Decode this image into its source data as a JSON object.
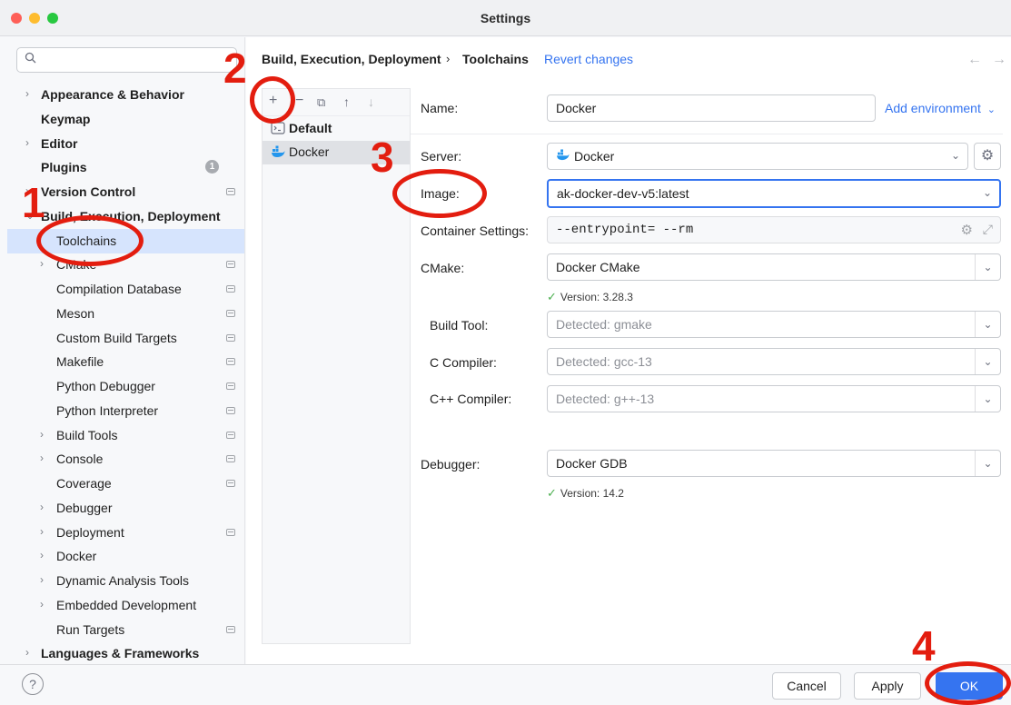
{
  "window": {
    "title": "Settings",
    "traffic_lights": [
      "#fe5f57",
      "#febc2e",
      "#28c840"
    ]
  },
  "sidebar": {
    "search_icon": "🔍",
    "items": [
      {
        "label": "Appearance & Behavior",
        "bold": true,
        "chevron": "›",
        "indent": 0
      },
      {
        "label": "Keymap",
        "bold": true,
        "chevron": "",
        "indent": 0
      },
      {
        "label": "Editor",
        "bold": true,
        "chevron": "›",
        "indent": 0
      },
      {
        "label": "Plugins",
        "bold": true,
        "chevron": "",
        "indent": 0,
        "badge": "1"
      },
      {
        "label": "Version Control",
        "bold": true,
        "chevron": "›",
        "indent": 0,
        "project": true
      },
      {
        "label": "Build, Execution, Deployment",
        "bold": true,
        "chevron": "⌄",
        "indent": 0
      },
      {
        "label": "Toolchains",
        "bold": false,
        "chevron": "",
        "indent": 1,
        "selected": true
      },
      {
        "label": "CMake",
        "bold": false,
        "chevron": "›",
        "indent": 1,
        "project": true
      },
      {
        "label": "Compilation Database",
        "bold": false,
        "chevron": "",
        "indent": 1,
        "project": true
      },
      {
        "label": "Meson",
        "bold": false,
        "chevron": "",
        "indent": 1,
        "project": true
      },
      {
        "label": "Custom Build Targets",
        "bold": false,
        "chevron": "",
        "indent": 1,
        "project": true
      },
      {
        "label": "Makefile",
        "bold": false,
        "chevron": "",
        "indent": 1,
        "project": true
      },
      {
        "label": "Python Debugger",
        "bold": false,
        "chevron": "",
        "indent": 1,
        "project": true
      },
      {
        "label": "Python Interpreter",
        "bold": false,
        "chevron": "",
        "indent": 1,
        "project": true
      },
      {
        "label": "Build Tools",
        "bold": false,
        "chevron": "›",
        "indent": 1,
        "project": true
      },
      {
        "label": "Console",
        "bold": false,
        "chevron": "›",
        "indent": 1,
        "project": true
      },
      {
        "label": "Coverage",
        "bold": false,
        "chevron": "",
        "indent": 1,
        "project": true
      },
      {
        "label": "Debugger",
        "bold": false,
        "chevron": "›",
        "indent": 1
      },
      {
        "label": "Deployment",
        "bold": false,
        "chevron": "›",
        "indent": 1,
        "project": true
      },
      {
        "label": "Docker",
        "bold": false,
        "chevron": "›",
        "indent": 1
      },
      {
        "label": "Dynamic Analysis Tools",
        "bold": false,
        "chevron": "›",
        "indent": 1
      },
      {
        "label": "Embedded Development",
        "bold": false,
        "chevron": "›",
        "indent": 1
      },
      {
        "label": "Run Targets",
        "bold": false,
        "chevron": "",
        "indent": 1,
        "project": true
      },
      {
        "label": "Languages & Frameworks",
        "bold": true,
        "chevron": "›",
        "indent": 0
      }
    ]
  },
  "header": {
    "breadcrumb_parent": "Build, Execution, Deployment",
    "breadcrumb_sep": "›",
    "breadcrumb_current": "Toolchains",
    "revert": "Revert changes",
    "back_icon": "←",
    "forward_icon": "→"
  },
  "toolchains": {
    "toolbar": {
      "add": "+",
      "remove": "−",
      "copy": "⧉",
      "up": "↑",
      "down": "↓"
    },
    "items": [
      {
        "label": "Default",
        "icon": "terminal-icon",
        "bold": true
      },
      {
        "label": "Docker",
        "icon": "docker-icon",
        "selected": true
      }
    ]
  },
  "form": {
    "name_label": "Name:",
    "name_value": "Docker",
    "add_environment": "Add environment",
    "server_label": "Server:",
    "server_value": "Docker",
    "image_label": "Image:",
    "image_value": "ak-docker-dev-v5:latest",
    "container_label": "Container Settings:",
    "container_value": "--entrypoint= --rm",
    "cmake_label": "CMake:",
    "cmake_value": "Docker CMake",
    "cmake_version": "Version: 3.28.3",
    "build_tool_label": "Build Tool:",
    "build_tool_placeholder": "Detected: gmake",
    "c_compiler_label": "C Compiler:",
    "c_compiler_placeholder": "Detected: gcc-13",
    "cpp_compiler_label": "C++ Compiler:",
    "cpp_compiler_placeholder": "Detected: g++-13",
    "debugger_label": "Debugger:",
    "debugger_value": "Docker GDB",
    "debugger_version": "Version: 14.2",
    "dropdown_chevron": "⌄",
    "check": "✓",
    "gear": "⚙",
    "expand": "⤢"
  },
  "footer": {
    "help": "?",
    "cancel": "Cancel",
    "apply": "Apply",
    "ok": "OK"
  },
  "annotations": {
    "color": "#e31d0f",
    "steps": [
      "1",
      "2",
      "3",
      "4"
    ]
  }
}
